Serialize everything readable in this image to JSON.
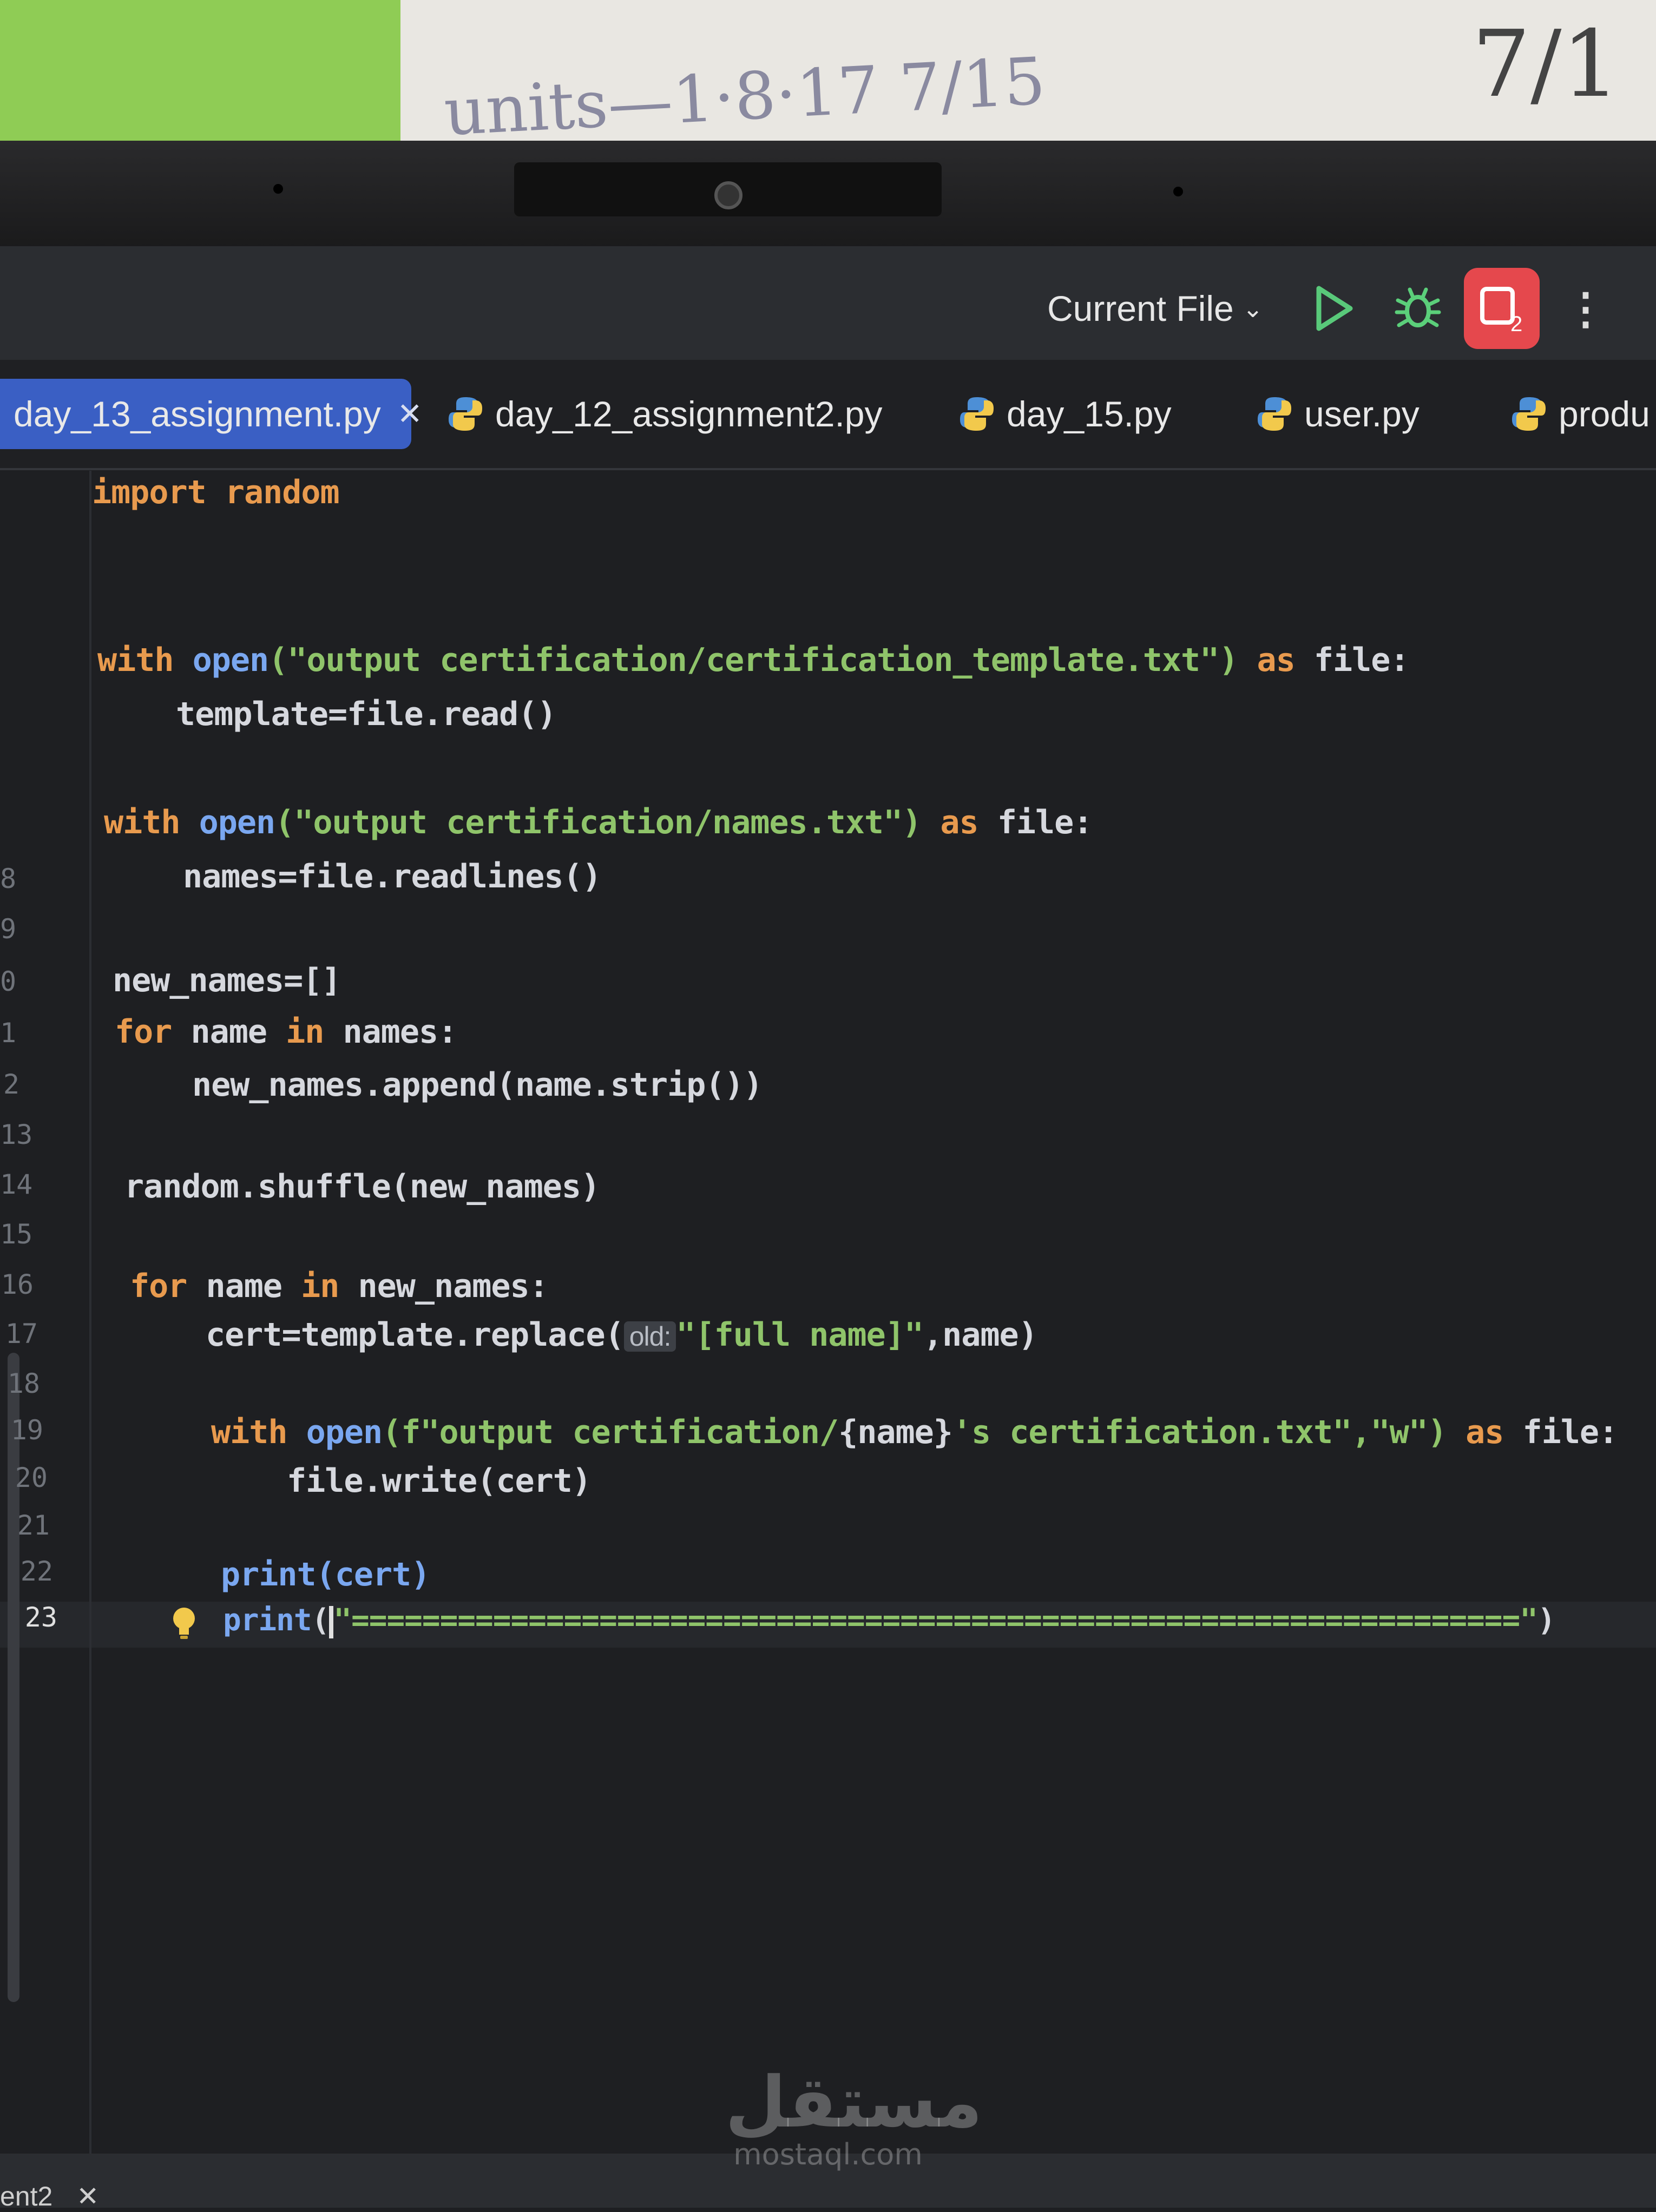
{
  "toolbar": {
    "run_config": "Current File"
  },
  "tabs": [
    {
      "label": "day_13_assignment.py",
      "active": true
    },
    {
      "label": "day_12_assignment2.py",
      "active": false
    },
    {
      "label": "day_15.py",
      "active": false
    },
    {
      "label": "user.py",
      "active": false
    },
    {
      "label": "produ",
      "active": false
    }
  ],
  "editor": {
    "current_line": "23",
    "line_numbers": [
      "8",
      "9",
      "0",
      "1",
      "2",
      "13",
      "14",
      "15",
      "16",
      "17",
      "18",
      "19",
      "20",
      "21",
      "22",
      "23"
    ],
    "code": {
      "l1": "import random",
      "l4a": "with ",
      "l4b": "open",
      "l4c": "(\"output certification/certification_template.txt\")",
      "l4d": " as ",
      "l4e": "file:",
      "l5": "template=file.read()",
      "l7a": "with ",
      "l7b": "open",
      "l7c": "(\"output certification/names.txt\")",
      "l7d": " as ",
      "l7e": "file:",
      "l8": "names=file.readlines()",
      "l10": "new_names=[]",
      "l11a": "for",
      "l11b": " name ",
      "l11c": "in",
      "l11d": " names:",
      "l12": "new_names.append(name.strip())",
      "l14": "random.shuffle(new_names)",
      "l16a": "for",
      "l16b": " name ",
      "l16c": "in",
      "l16d": " new_names:",
      "l17a": "cert=template.replace(",
      "l17hint": "old:",
      "l17b": "\"[full name]\"",
      "l17c": ",name)",
      "l19a": "with ",
      "l19b": "open",
      "l19c": "(f\"output certification/",
      "l19d": "{name}",
      "l19e": "'s certification.txt\",\"w\")",
      "l19f": " as ",
      "l19g": "file:",
      "l20": "file.write(cert)",
      "l22": "print(cert)",
      "l23a": "print",
      "l23b": "(",
      "l23c": "\"==================================================================\"",
      "l23d": ")"
    }
  },
  "bottom": {
    "tab_label": "ent2"
  },
  "watermark": {
    "arabic": "مستقل",
    "latin": "mostaql.com"
  },
  "colors": {
    "background": "#1e1f22",
    "keyword": "#e89a4e",
    "function": "#7aa7f0",
    "string": "#8fc46a",
    "active_tab": "#3a5fc4",
    "profile_button": "#e5484d"
  }
}
